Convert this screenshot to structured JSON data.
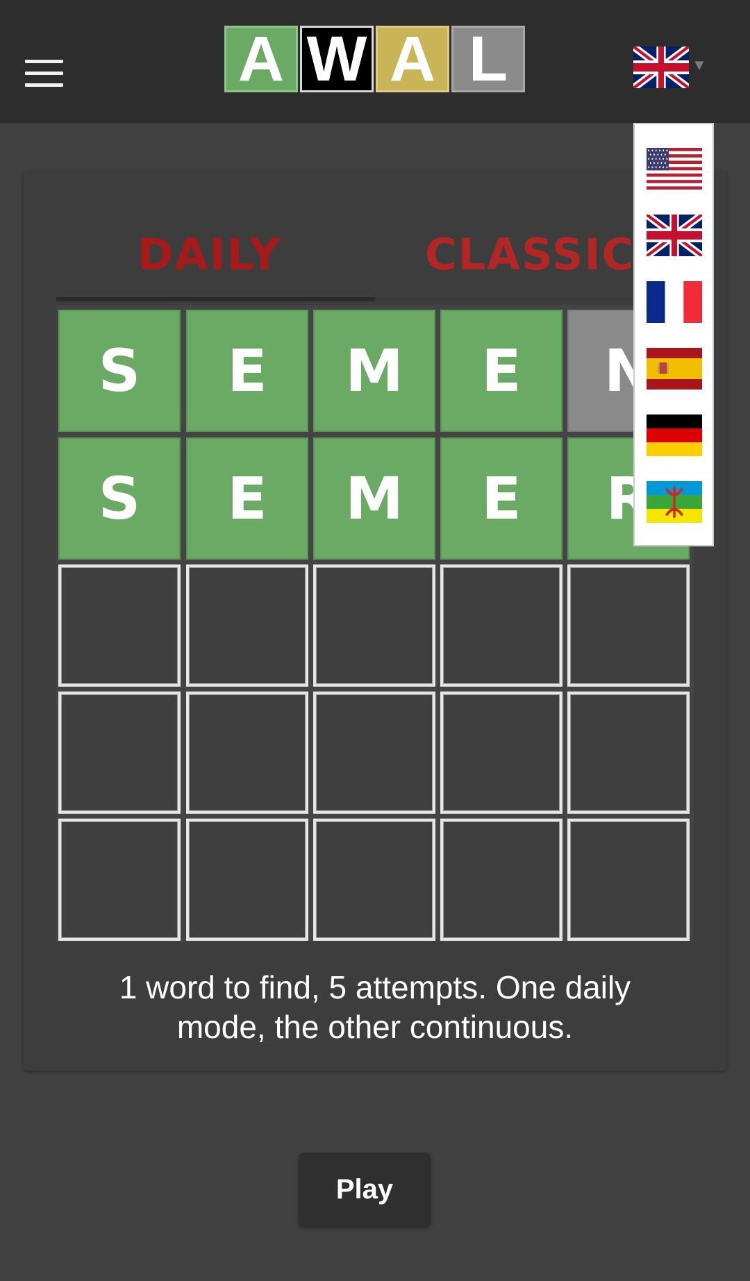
{
  "header": {
    "menu_icon": "hamburger-menu-icon",
    "logo_letters": [
      "A",
      "W",
      "A",
      "L"
    ],
    "logo_colors": [
      "#6aaa64",
      "#000000",
      "#c9b458",
      "#8b8b8b"
    ],
    "current_language_icon": "uk-flag-icon"
  },
  "tabs": [
    {
      "label": "DAILY",
      "active": true
    },
    {
      "label": "CLASSIC",
      "active": false
    }
  ],
  "board": {
    "rows": [
      {
        "letters": [
          "S",
          "E",
          "M",
          "E",
          "N"
        ],
        "states": [
          "correct",
          "correct",
          "correct",
          "correct",
          "absent"
        ]
      },
      {
        "letters": [
          "S",
          "E",
          "M",
          "E",
          "R"
        ],
        "states": [
          "correct",
          "correct",
          "correct",
          "correct",
          "correct"
        ]
      },
      {
        "letters": [
          "",
          "",
          "",
          "",
          ""
        ],
        "states": [
          "empty",
          "empty",
          "empty",
          "empty",
          "empty"
        ]
      },
      {
        "letters": [
          "",
          "",
          "",
          "",
          ""
        ],
        "states": [
          "empty",
          "empty",
          "empty",
          "empty",
          "empty"
        ]
      },
      {
        "letters": [
          "",
          "",
          "",
          "",
          ""
        ],
        "states": [
          "empty",
          "empty",
          "empty",
          "empty",
          "empty"
        ]
      }
    ],
    "colors": {
      "correct": "#6aaa64",
      "absent": "#8a8a8a"
    }
  },
  "description": "1 word to find, 5 attempts. One daily mode, the other continuous.",
  "play_button": "Play",
  "language_dropdown": {
    "options": [
      "us-flag-icon",
      "uk-flag-icon",
      "france-flag-icon",
      "spain-flag-icon",
      "germany-flag-icon",
      "amazigh-flag-icon"
    ]
  }
}
